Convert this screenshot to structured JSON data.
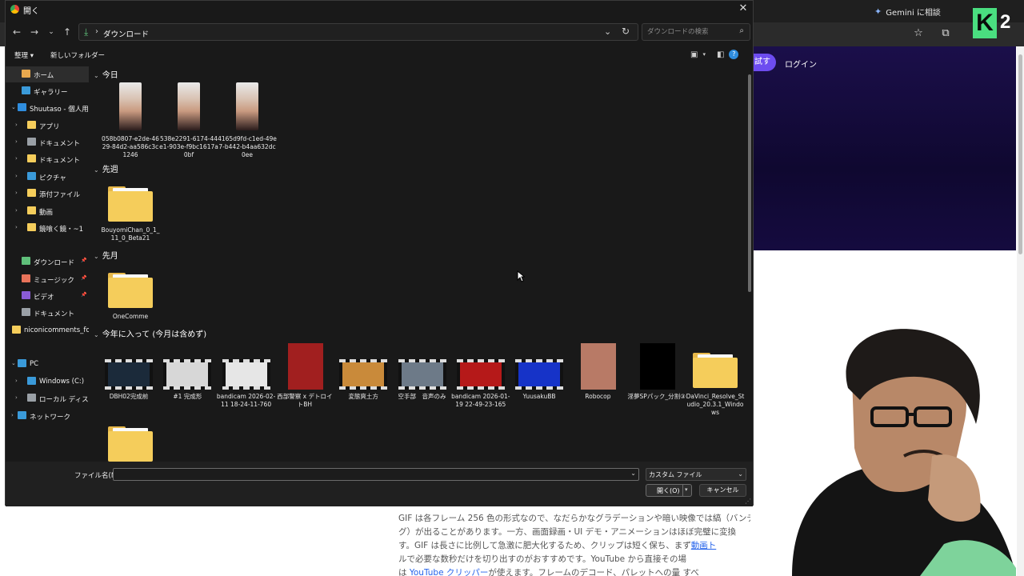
{
  "background_browser": {
    "gemini_label": "Gemini に相談",
    "try_label": "試す",
    "login_label": "ログイン",
    "logo_letter": "K",
    "logo_number": "2",
    "article_lines": [
      "GIF は各フレーム 256 色の形式なので、なだらかなグラデーションや暗い映像では縞（バンディ",
      "グ）が出ることがあります。一方、画面録画・UI デモ・アニメーションはほぼ完璧に変換",
      "す。GIF は長さに比例して急激に肥大化するため、クリップは短く保ち、まず",
      "ルで必要な数秒だけを切り出すのがおすすめです。YouTube から直接その場",
      "は",
      "が使えます。フレームのデコード、パレットへの量"
    ],
    "article_link_1": "動画ト",
    "article_link_2": "YouTube クリッパー",
    "article_tail": "すべ",
    "hero_color": "#150b3f",
    "accent_color": "#6d4cf0"
  },
  "dialog": {
    "title": "開く",
    "breadcrumb": "ダウンロード",
    "search_placeholder": "ダウンロードの検索",
    "commands": {
      "organize": "整理 ▾",
      "new_folder": "新しいフォルダー"
    },
    "sidebar": [
      {
        "label": "ホーム",
        "icon": "home-icon",
        "color": "#e9a94e",
        "selected": true,
        "chevron": "",
        "indent": 1,
        "pin": false
      },
      {
        "label": "ギャラリー",
        "icon": "gallery-icon",
        "color": "#3a9ad9",
        "selected": false,
        "chevron": "",
        "indent": 1,
        "pin": false
      },
      {
        "label": "Shuutaso - 個人用",
        "icon": "cloud-icon",
        "color": "#2f8dde",
        "selected": false,
        "chevron": "⌄",
        "indent": 0,
        "pin": false
      },
      {
        "label": "アプリ",
        "icon": "folder-icon",
        "color": "#f5cd5b",
        "selected": false,
        "chevron": "›",
        "indent": 1,
        "pin": false
      },
      {
        "label": "ドキュメント",
        "icon": "document-icon",
        "color": "#9aa0a6",
        "selected": false,
        "chevron": "›",
        "indent": 1,
        "pin": false
      },
      {
        "label": "ドキュメント",
        "icon": "folder-icon",
        "color": "#f5cd5b",
        "selected": false,
        "chevron": "›",
        "indent": 1,
        "pin": false
      },
      {
        "label": "ピクチャ",
        "icon": "pictures-icon",
        "color": "#3a9ad9",
        "selected": false,
        "chevron": "›",
        "indent": 1,
        "pin": false
      },
      {
        "label": "添付ファイル",
        "icon": "folder-icon",
        "color": "#f5cd5b",
        "selected": false,
        "chevron": "›",
        "indent": 1,
        "pin": false
      },
      {
        "label": "動画",
        "icon": "folder-icon",
        "color": "#f5cd5b",
        "selected": false,
        "chevron": "›",
        "indent": 1,
        "pin": false
      },
      {
        "label": "鏡喰く鏡・~1",
        "icon": "folder-icon",
        "color": "#f5cd5b",
        "selected": false,
        "chevron": "›",
        "indent": 1,
        "pin": false
      },
      {
        "label": "ダウンロード",
        "icon": "download-icon",
        "color": "#5fbf7a",
        "selected": false,
        "chevron": "",
        "indent": 1,
        "pin": true
      },
      {
        "label": "ミュージック",
        "icon": "music-icon",
        "color": "#e8735a",
        "selected": false,
        "chevron": "",
        "indent": 1,
        "pin": true
      },
      {
        "label": "ビデオ",
        "icon": "video-icon",
        "color": "#8a5bd6",
        "selected": false,
        "chevron": "",
        "indent": 1,
        "pin": true
      },
      {
        "label": "ドキュメント",
        "icon": "document-icon",
        "color": "#9aa0a6",
        "selected": false,
        "chevron": "",
        "indent": 1,
        "pin": false
      },
      {
        "label": "niconicomments_fo",
        "icon": "folder-icon",
        "color": "#f5cd5b",
        "selected": false,
        "chevron": "",
        "indent": 0,
        "pin": false
      },
      {
        "label": "PC",
        "icon": "pc-icon",
        "color": "#3a9ad9",
        "selected": false,
        "chevron": "⌄",
        "indent": 0,
        "pin": false
      },
      {
        "label": "Windows (C:)",
        "icon": "drive-icon",
        "color": "#3a9ad9",
        "selected": false,
        "chevron": "›",
        "indent": 1,
        "pin": false
      },
      {
        "label": "ローカル ディスク (D:",
        "icon": "drive-icon",
        "color": "#9aa0a6",
        "selected": false,
        "chevron": "›",
        "indent": 1,
        "pin": false
      },
      {
        "label": "ネットワーク",
        "icon": "network-icon",
        "color": "#3a9ad9",
        "selected": false,
        "chevron": "›",
        "indent": 0,
        "pin": false
      }
    ],
    "groups": [
      {
        "label": "今日"
      },
      {
        "label": "先週"
      },
      {
        "label": "先月"
      },
      {
        "label": "今年に入って (今月は含めず)"
      }
    ],
    "files_today": [
      {
        "name": "058b0807-e2de-4629-84d2-aa586c3c1246",
        "kind": "portrait"
      },
      {
        "name": "538e2291-6174-44e1-903e-f9bc1617a0bf",
        "kind": "portrait"
      },
      {
        "name": "4165d9fd-c1ed-49e7-b442-b4aa632dc0ee",
        "kind": "portrait"
      }
    ],
    "files_last_week": [
      {
        "name": "BouyomiChan_0_1_11_0_Beta21",
        "kind": "folder"
      }
    ],
    "files_last_month": [
      {
        "name": "OneComme",
        "kind": "folder"
      }
    ],
    "files_this_year": [
      {
        "name": "DBH02完成前",
        "kind": "video",
        "color": "#1b2a3a"
      },
      {
        "name": "#1 完成形",
        "kind": "video",
        "color": "#d7d7d7"
      },
      {
        "name": "bandicam 2026-02-11 18-24-11-760",
        "kind": "video",
        "color": "#e6e6e6"
      },
      {
        "name": "西部警察 x デトロイトBH",
        "kind": "image",
        "color": "#a11f1f"
      },
      {
        "name": "変態爽土方",
        "kind": "video",
        "color": "#c98a3a"
      },
      {
        "name": "空手部　音声のみ",
        "kind": "video",
        "color": "#6d7a88"
      },
      {
        "name": "bandicam 2026-01-19 22-49-23-165",
        "kind": "video",
        "color": "#b51919"
      },
      {
        "name": "YuusakuBB",
        "kind": "video",
        "color": "#1633c8"
      },
      {
        "name": "Robocop",
        "kind": "image",
        "color": "#b87a66"
      },
      {
        "name": "淫夢SPパック_分割③",
        "kind": "image",
        "color": "#000000"
      },
      {
        "name": "DaVinci_Resolve_Studio_20.3.1_Windows",
        "kind": "folder"
      }
    ],
    "file_name_label": "ファイル名(N):",
    "file_name_value": "",
    "file_type": "カスタム ファイル",
    "open_label": "開く(O)",
    "cancel_label": "キャンセル"
  }
}
